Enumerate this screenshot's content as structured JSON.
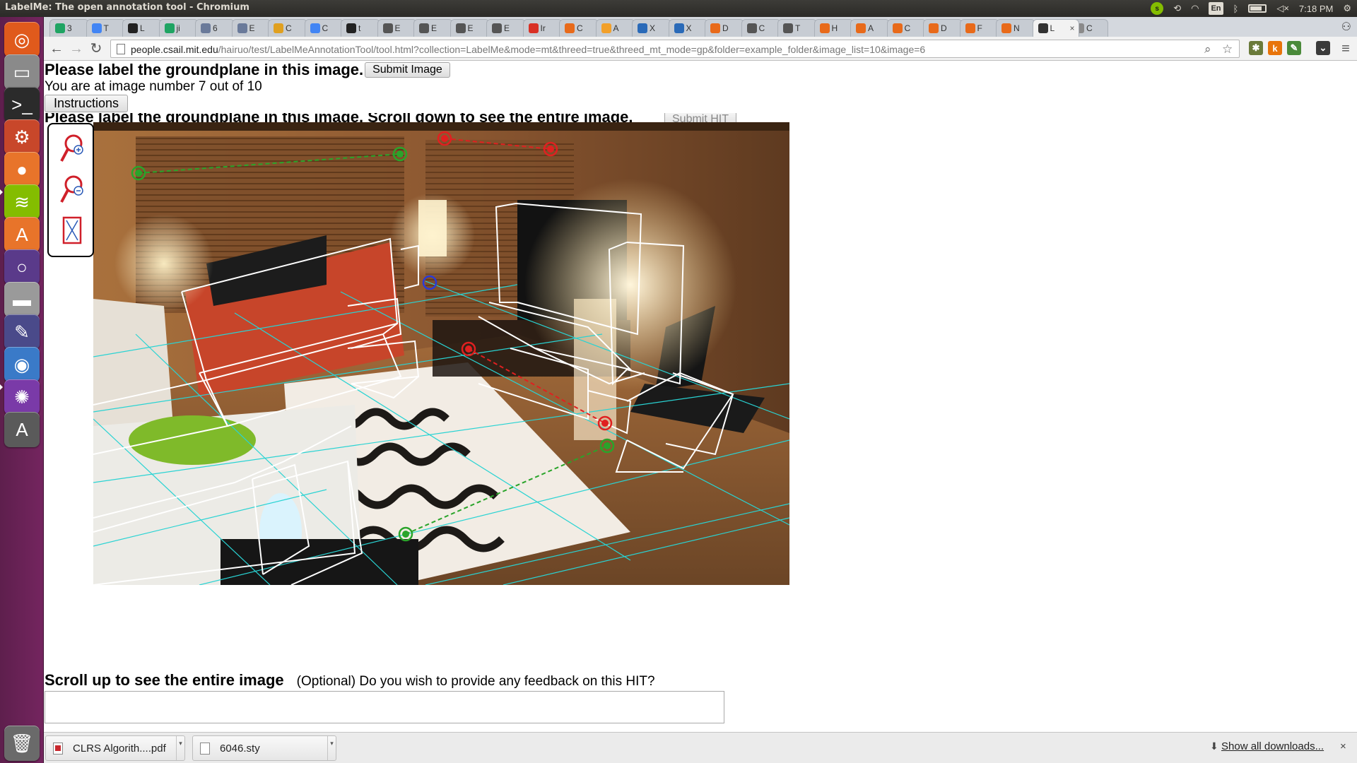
{
  "window": {
    "title": "LabelMe: The open annotation tool - Chromium"
  },
  "panel": {
    "clock": "7:18 PM",
    "lang": "En",
    "spotify": "s",
    "icons": [
      "spotify-icon",
      "sync-icon",
      "wifi-icon",
      "keyboard-layout-icon",
      "bluetooth-icon",
      "battery-icon",
      "volume-mute-icon",
      "clock",
      "gear-icon"
    ]
  },
  "launcher": {
    "items": [
      {
        "name": "ubuntu-dash-icon",
        "glyph": "◎",
        "color": "#e05a1c"
      },
      {
        "name": "file-manager-icon",
        "glyph": "▭",
        "color": "#8a8a8a"
      },
      {
        "name": "terminal-icon",
        "glyph": ">_",
        "color": "#2b2b2b"
      },
      {
        "name": "system-settings-icon",
        "glyph": "⚙",
        "color": "#c8472a"
      },
      {
        "name": "firefox-icon",
        "glyph": "●",
        "color": "#e8742a"
      },
      {
        "name": "spotify-icon",
        "glyph": "≋",
        "color": "#84bd00"
      },
      {
        "name": "software-center-icon",
        "glyph": "A",
        "color": "#e8742a"
      },
      {
        "name": "unity-tweak-icon",
        "glyph": "○",
        "color": "#5a3a8a"
      },
      {
        "name": "disk-drive-icon",
        "glyph": "▬",
        "color": "#9a9a9a"
      },
      {
        "name": "inkscape-icon",
        "glyph": "✎",
        "color": "#4a4a8a"
      },
      {
        "name": "chromium-icon",
        "glyph": "◉",
        "color": "#3a7ac8"
      },
      {
        "name": "spiral-app-icon",
        "glyph": "✺",
        "color": "#7a3aa8"
      },
      {
        "name": "software-updater-icon",
        "glyph": "A",
        "color": "#5a5a5a"
      },
      {
        "name": "trash-icon",
        "glyph": "🗑",
        "color": "#6a6a6a"
      }
    ]
  },
  "tabs": [
    {
      "label": "3",
      "fav": "drive",
      "color": "#1fa463"
    },
    {
      "label": "T",
      "fav": "doc",
      "color": "#4285f4"
    },
    {
      "label": "L",
      "fav": "github",
      "color": "#222222"
    },
    {
      "label": "ji",
      "fav": "drive",
      "color": "#1fa463"
    },
    {
      "label": "6",
      "fav": "pin",
      "color": "#6a7a9a"
    },
    {
      "label": "E",
      "fav": "pin",
      "color": "#6a7a9a"
    },
    {
      "label": "C",
      "fav": "mixed",
      "color": "#e0a020"
    },
    {
      "label": "C",
      "fav": "doc",
      "color": "#4285f4"
    },
    {
      "label": "t",
      "fav": "github",
      "color": "#222222"
    },
    {
      "label": "E",
      "fav": "wiki",
      "color": "#555555"
    },
    {
      "label": "E",
      "fav": "wiki",
      "color": "#555555"
    },
    {
      "label": "E",
      "fav": "wiki",
      "color": "#555555"
    },
    {
      "label": "E",
      "fav": "wiki",
      "color": "#555555"
    },
    {
      "label": "Ir",
      "fav": "gmail",
      "color": "#d93025"
    },
    {
      "label": "C",
      "fav": "matlab",
      "color": "#e86a1a"
    },
    {
      "label": "A",
      "fav": "orange",
      "color": "#f2a02a"
    },
    {
      "label": "X",
      "fav": "w3",
      "color": "#2a6ab8"
    },
    {
      "label": "X",
      "fav": "w3",
      "color": "#2a6ab8"
    },
    {
      "label": "D",
      "fav": "matlab",
      "color": "#e86a1a"
    },
    {
      "label": "C",
      "fav": "wiki",
      "color": "#555555"
    },
    {
      "label": "T",
      "fav": "wiki",
      "color": "#555555"
    },
    {
      "label": "H",
      "fav": "matlab",
      "color": "#e86a1a"
    },
    {
      "label": "A",
      "fav": "matlab",
      "color": "#e86a1a"
    },
    {
      "label": "C",
      "fav": "matlab",
      "color": "#e86a1a"
    },
    {
      "label": "D",
      "fav": "matlab",
      "color": "#e86a1a"
    },
    {
      "label": "F",
      "fav": "matlab",
      "color": "#e86a1a"
    },
    {
      "label": "N",
      "fav": "matlab",
      "color": "#e86a1a"
    },
    {
      "label": "L",
      "fav": "labelme",
      "color": "#333333",
      "active": true
    },
    {
      "label": "C",
      "fav": "page",
      "color": "#8a8a8a"
    }
  ],
  "toolbar": {
    "url_host": "people.csail.mit.edu",
    "url_path": "/hairuo/test/LabelMeAnnotationTool/tool.html?collection=LabelMe&mode=mt&threed=true&threed_mt_mode=gp&folder=example_folder&image_list=10&image=6",
    "extensions": [
      {
        "name": "extension-puzzle-icon",
        "glyph": "✱",
        "color": "#6a7a3a"
      },
      {
        "name": "extension-k-icon",
        "glyph": "k",
        "color": "#e8740a"
      },
      {
        "name": "extension-badge-icon",
        "glyph": "✎",
        "color": "#4a8a3a"
      },
      {
        "name": "pocket-icon",
        "glyph": "⌄",
        "color": "#3a3a3a"
      }
    ]
  },
  "page": {
    "title": "Please label the groundplane in this image.",
    "submit_image": "Submit Image",
    "progress": "You are at image number 7 out of 10",
    "instructions": "Instructions",
    "scroll_down_heading": "Please label the groundplane in this image. Scroll down to see the entire image.",
    "submit_hit": "Submit HIT",
    "scroll_up": "Scroll up to see the entire image",
    "feedback_label": "(Optional) Do you wish to provide any feedback on this HIT?",
    "feedback_value": ""
  },
  "downloads": [
    {
      "name": "CLRS Algorith....pdf",
      "type": "pdf"
    },
    {
      "name": "6046.sty",
      "type": "file"
    }
  ],
  "shelf": {
    "show_all": "Show all downloads...",
    "close": "×"
  }
}
